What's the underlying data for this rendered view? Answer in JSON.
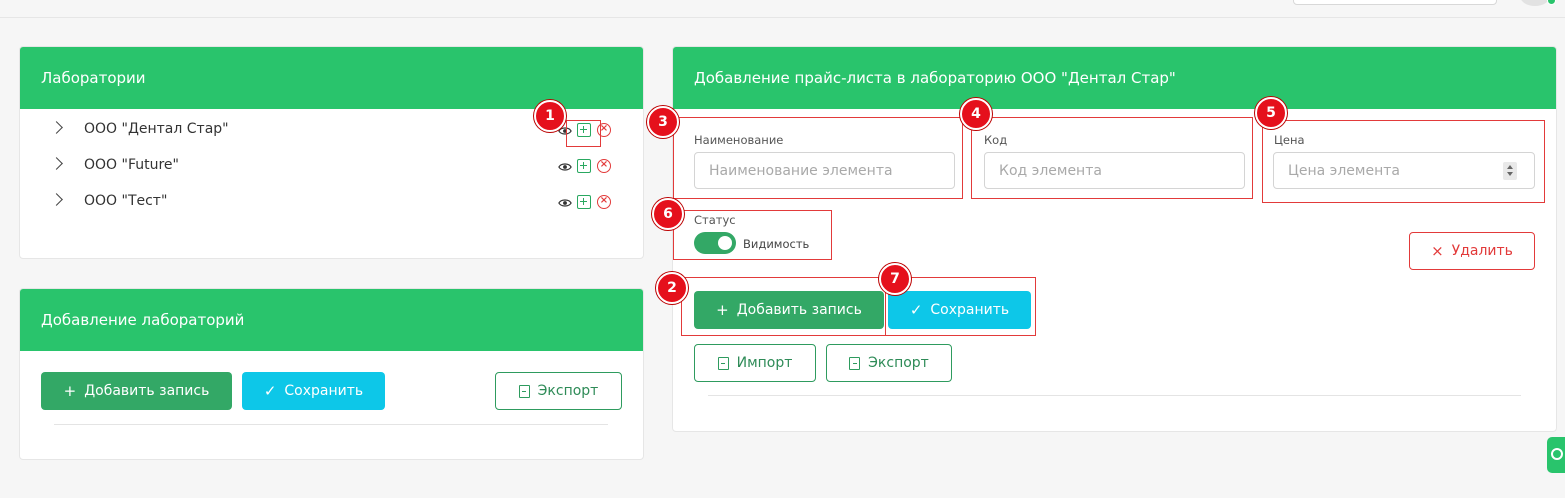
{
  "labs_panel": {
    "title": "Лаборатории",
    "items": [
      {
        "label": "ООО \"Дентал Стар\""
      },
      {
        "label": "ООО \"Future\""
      },
      {
        "label": "ООО \"Тест\""
      }
    ]
  },
  "add_labs_panel": {
    "title": "Добавление лабораторий",
    "add_label": "Добавить запись",
    "save_label": "Сохранить",
    "export_label": "Экспорт"
  },
  "price_panel": {
    "title": "Добавление прайс-листа в лабораторию ООО \"Дентал Стар\"",
    "name_field": {
      "label": "Наименование",
      "placeholder": "Наименование элемента",
      "value": ""
    },
    "code_field": {
      "label": "Код",
      "placeholder": "Код элемента",
      "value": ""
    },
    "price_field": {
      "label": "Цена",
      "placeholder": "Цена элемента",
      "value": ""
    },
    "status": {
      "label": "Статус",
      "toggle_label": "Видимость",
      "enabled": true
    },
    "delete_label": "Удалить",
    "add_label": "Добавить запись",
    "save_label": "Сохранить",
    "import_label": "Импорт",
    "export_label": "Экспорт"
  },
  "annotations": [
    "1",
    "2",
    "3",
    "4",
    "5",
    "6",
    "7"
  ],
  "colors": {
    "header_green": "#29c46c",
    "button_green": "#33a866",
    "button_cyan": "#0dc7e8",
    "danger_red": "#e23a3a",
    "annotation_red": "#e5101c"
  }
}
